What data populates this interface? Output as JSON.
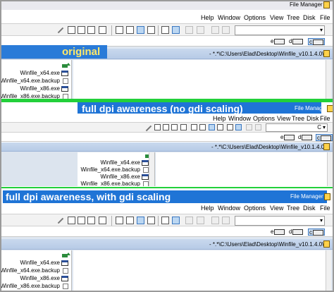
{
  "app": {
    "title": "File Manager"
  },
  "menu": [
    "Help",
    "Window",
    "Options",
    "View",
    "Tree",
    "Disk",
    "File"
  ],
  "drives": [
    {
      "letter": "e",
      "icon": "network-drive-icon"
    },
    {
      "letter": "d",
      "icon": "fixed-drive-icon"
    },
    {
      "letter": "c",
      "icon": "fixed-drive-icon"
    }
  ],
  "drive_combo": {
    "value": "C"
  },
  "child_window": {
    "path": "- *.*\\C:\\Users\\Elad\\Desktop\\Winfile_v10.1.4.0\\"
  },
  "files": [
    {
      "name": "Winfile_x64.exe",
      "type": "exe"
    },
    {
      "name": "Winfile_x64.exe.backup",
      "type": "doc"
    },
    {
      "name": "Winfile_x86.exe",
      "type": "exe"
    },
    {
      "name": "Winfile_x86.exe.backup",
      "type": "doc"
    }
  ],
  "sections": {
    "original": {
      "label": "original"
    },
    "dpi_no_gdi": {
      "label": "full dpi awareness (no gdi scaling)"
    },
    "dpi_gdi": {
      "label": "full dpi awareness, with gdi scaling"
    }
  },
  "colors": {
    "label_bar": "#1f74d6",
    "separator": "#22d03a",
    "mdi_title": "#b7cbe6"
  }
}
